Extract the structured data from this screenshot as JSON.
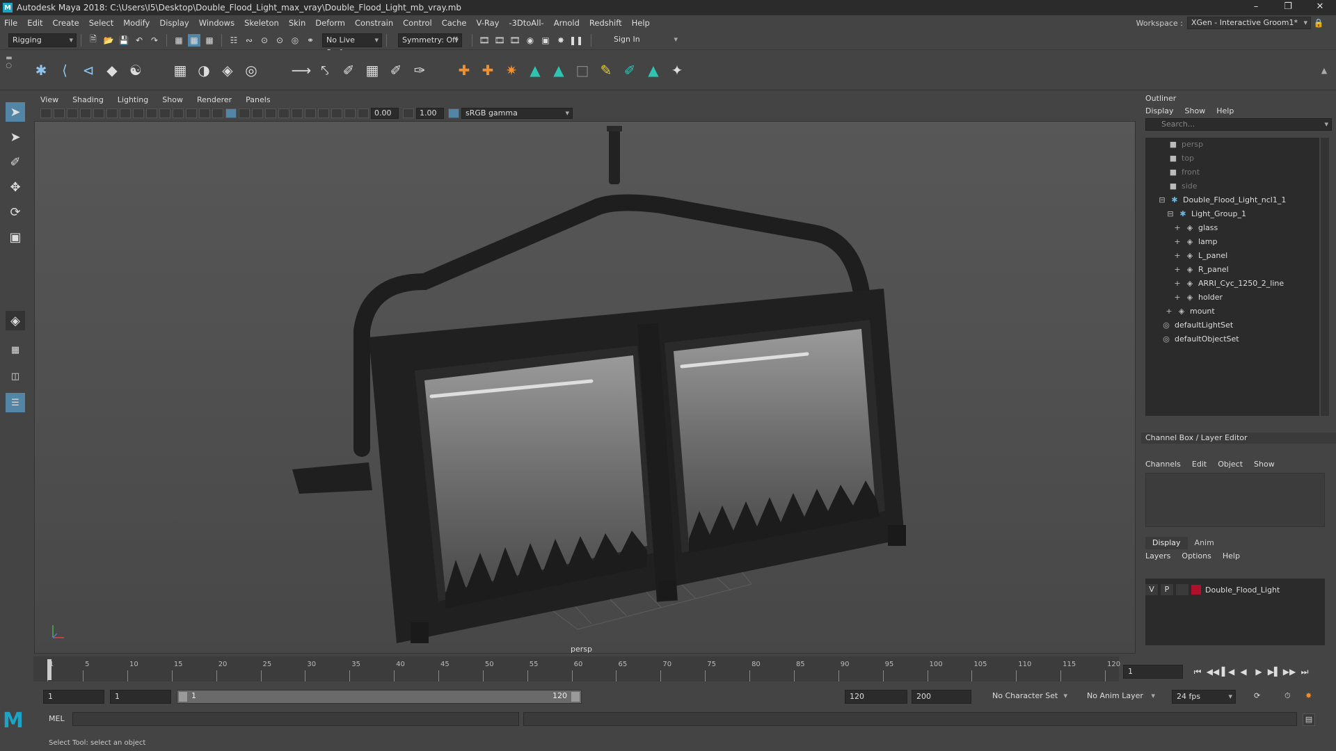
{
  "window": {
    "title": "Autodesk Maya 2018: C:\\Users\\I5\\Desktop\\Double_Flood_Light_max_vray\\Double_Flood_Light_mb_vray.mb"
  },
  "menubar": {
    "items": [
      "File",
      "Edit",
      "Create",
      "Select",
      "Modify",
      "Display",
      "Windows",
      "Skeleton",
      "Skin",
      "Deform",
      "Constrain",
      "Control",
      "Cache",
      "V-Ray",
      "-3DtoAll-",
      "Arnold",
      "Redshift",
      "Help"
    ]
  },
  "workspace": {
    "label": "Workspace :",
    "value": "XGen - Interactive Groom1*"
  },
  "statusline": {
    "mode": "Rigging",
    "live_surface": "No Live Surface",
    "symmetry": "Symmetry: Off",
    "sign_in": "Sign In"
  },
  "viewport": {
    "menu": [
      "View",
      "Shading",
      "Lighting",
      "Show",
      "Renderer",
      "Panels"
    ],
    "exposure": "0.00",
    "gamma": "1.00",
    "color_space": "sRGB gamma",
    "camera_label": "persp"
  },
  "outliner": {
    "title": "Outliner",
    "menu": [
      "Display",
      "Show",
      "Help"
    ],
    "search_placeholder": "Search...",
    "items": [
      {
        "label": "persp",
        "dim": true
      },
      {
        "label": "top",
        "dim": true
      },
      {
        "label": "front",
        "dim": true
      },
      {
        "label": "side",
        "dim": true
      },
      {
        "label": "Double_Flood_Light_ncl1_1",
        "dim": false
      },
      {
        "label": "Light_Group_1",
        "dim": false
      },
      {
        "label": "glass",
        "dim": false
      },
      {
        "label": "lamp",
        "dim": false
      },
      {
        "label": "L_panel",
        "dim": false
      },
      {
        "label": "R_panel",
        "dim": false
      },
      {
        "label": "ARRI_Cyc_1250_2_line",
        "dim": false
      },
      {
        "label": "holder",
        "dim": false
      },
      {
        "label": "mount",
        "dim": false
      },
      {
        "label": "defaultLightSet",
        "dim": false
      },
      {
        "label": "defaultObjectSet",
        "dim": false
      }
    ]
  },
  "channelbox": {
    "title": "Channel Box / Layer Editor",
    "menu": [
      "Channels",
      "Edit",
      "Object",
      "Show"
    ]
  },
  "layereditor": {
    "tabs": [
      "Display",
      "Anim"
    ],
    "menu": [
      "Layers",
      "Options",
      "Help"
    ],
    "layer": {
      "v": "V",
      "p": "P",
      "name": "Double_Flood_Light",
      "color": "#b0102a"
    }
  },
  "timeline": {
    "ticks": [
      "1",
      "5",
      "10",
      "15",
      "20",
      "25",
      "30",
      "35",
      "40",
      "45",
      "50",
      "55",
      "60",
      "65",
      "70",
      "75",
      "80",
      "85",
      "90",
      "95",
      "100",
      "105",
      "110",
      "115",
      "120"
    ],
    "current_frame": "1"
  },
  "range": {
    "start": "1",
    "playback_start": "1",
    "bar_start": "1",
    "bar_end": "120",
    "playback_end": "120",
    "end": "200",
    "character_set": "No Character Set",
    "anim_layer": "No Anim Layer",
    "fps": "24 fps"
  },
  "commandline": {
    "label": "MEL"
  },
  "helpline": {
    "text": "Select Tool: select an object"
  }
}
